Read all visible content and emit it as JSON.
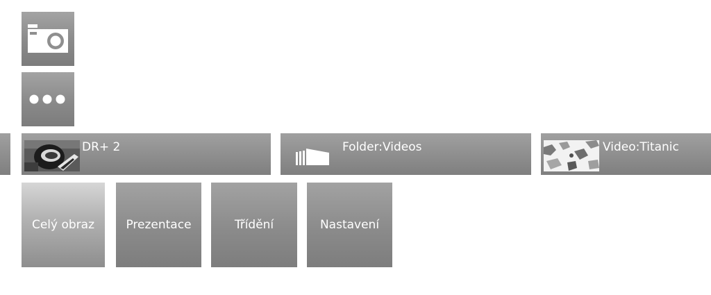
{
  "icons": {
    "top": "camera-icon",
    "second": "more-icon"
  },
  "bars": {
    "channel": {
      "label": "DR+ 2"
    },
    "folder": {
      "label": "Folder:Videos"
    },
    "video": {
      "label": "Video:Titanic"
    }
  },
  "buttons": {
    "fullscreen": "Celý obraz",
    "slideshow": "Prezentace",
    "sort": "Třídění",
    "settings": "Nastavení"
  }
}
